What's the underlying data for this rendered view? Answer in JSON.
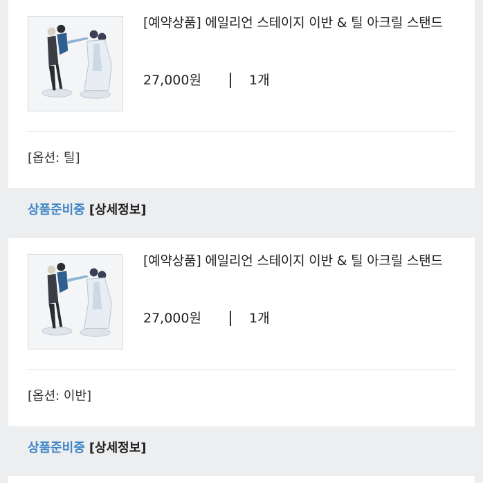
{
  "orders": [
    {
      "title": "[예약상품] 에일리언 스테이지 이반 & 틸 아크릴 스탠드",
      "price": "27,000원",
      "quantity": "1개",
      "option": "[옵션: 틸]",
      "status": "상품준비중",
      "detail_link": "[상세정보]"
    },
    {
      "title": "[예약상품] 에일리언 스테이지 이반 & 틸 아크릴 스탠드",
      "price": "27,000원",
      "quantity": "1개",
      "option": "[옵션: 이반]",
      "status": "상품준비중",
      "detail_link": "[상세정보]"
    }
  ],
  "colors": {
    "status_blue": "#3f86c7",
    "background": "#eceef0",
    "card": "#ffffff"
  }
}
